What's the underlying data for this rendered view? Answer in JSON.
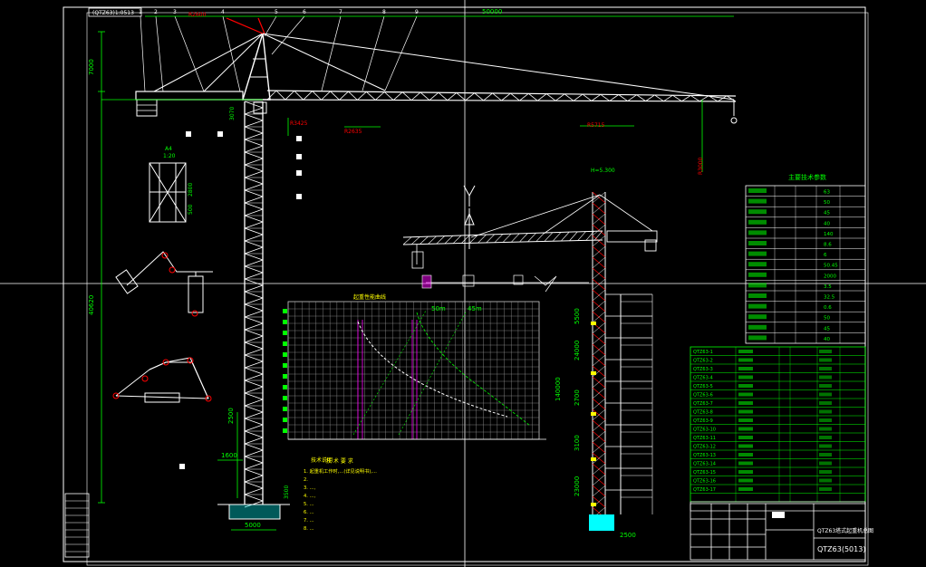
{
  "colors": {
    "background": "#000000",
    "structure": "#ffffff",
    "dimension": "#00ff00",
    "note_text": "#ffff00",
    "highlight": "#ff0000",
    "pink": "#ff00ff",
    "cyan": "#00ffff",
    "grid": "#aaaaaa"
  },
  "title_block": {
    "stamp": "QTZ63(5013)",
    "header": "(QTZ63)1:0513",
    "drawing_title": "QTZ63塔式起重机总图"
  },
  "jib": {
    "callouts": [
      "1",
      "2",
      "3",
      "4",
      "5",
      "6",
      "7",
      "8",
      "9"
    ],
    "length_label": "50000",
    "height_label": "7000",
    "top_label": "R2600",
    "dims": [
      "R3425",
      "R2635",
      "R5715",
      "R3000"
    ]
  },
  "mast": {
    "height_label": "40620",
    "base_width": "5000",
    "labels": [
      "1600",
      "2500",
      "3070",
      "3500"
    ]
  },
  "detail": {
    "label": "A4",
    "scale": "1:20",
    "dims": [
      "2800",
      "500"
    ]
  },
  "load_chart": {
    "title": "起重性能曲线",
    "curve_labels": [
      "50m",
      "45m"
    ],
    "title_notes": "技术说明"
  },
  "notes": {
    "heading": "技 术 要 求",
    "lines": [
      "1. 起重机工作时,...(详见说明书),...",
      "2.",
      "3. ...,",
      "4. ...,",
      "5. ...",
      "6. ...",
      "7. ...",
      "8. ..."
    ]
  },
  "building_view": {
    "dims": [
      "5500",
      "24000",
      "2700",
      "140000",
      "3100",
      "23000",
      "2500"
    ],
    "height_label": "H=5.300"
  },
  "spec_table": {
    "title": "主要技术参数",
    "rows_visible": 15,
    "sample": [
      "63",
      "50",
      "45",
      "40",
      "140",
      "8.6",
      "6",
      "50.45",
      "2000",
      "3.5",
      "32.5",
      "0.6",
      "50",
      "45",
      "40"
    ]
  },
  "parts_list": {
    "rows_visible": 18,
    "codes": [
      "QTZ63-1",
      "QTZ63-2",
      "QTZ63-3",
      "QTZ63-4",
      "QTZ63-5",
      "QTZ63-6",
      "QTZ63-7",
      "QTZ63-8",
      "QTZ63-9",
      "QTZ63-10",
      "QTZ63-11",
      "QTZ63-12",
      "QTZ63-13",
      "QTZ63-14",
      "QTZ63-15",
      "QTZ63-16",
      "QTZ63-17"
    ]
  }
}
